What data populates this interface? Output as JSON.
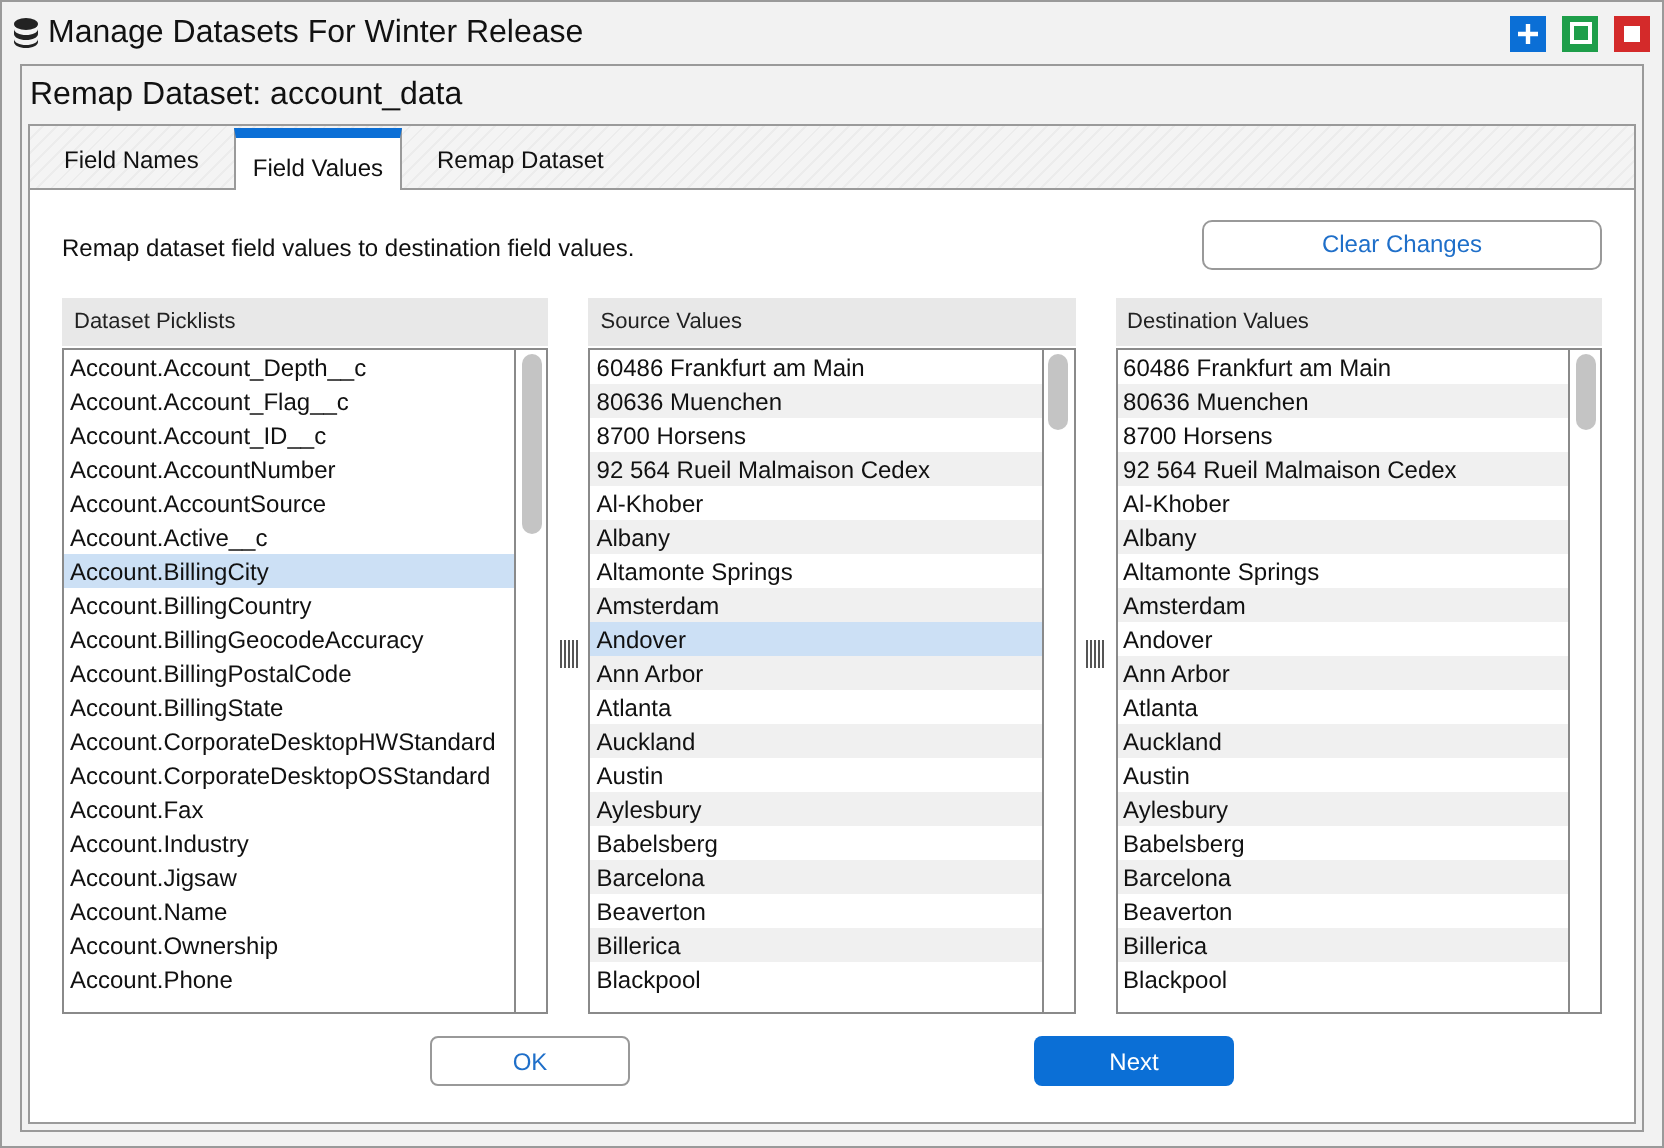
{
  "window": {
    "title": "Manage Datasets For Winter Release"
  },
  "dialog": {
    "title": "Remap Dataset: account_data"
  },
  "tabs": [
    {
      "label": "Field Names",
      "selected": false
    },
    {
      "label": "Field Values",
      "selected": true
    },
    {
      "label": "Remap Dataset",
      "selected": false
    }
  ],
  "description": "Remap dataset field values to destination field values.",
  "clear_button": "Clear Changes",
  "lists": [
    {
      "header": "Dataset Picklists",
      "striped": false,
      "items": [
        {
          "label": "Account.Account_Depth__c",
          "selected": false
        },
        {
          "label": "Account.Account_Flag__c",
          "selected": false
        },
        {
          "label": "Account.Account_ID__c",
          "selected": false
        },
        {
          "label": "Account.AccountNumber",
          "selected": false
        },
        {
          "label": "Account.AccountSource",
          "selected": false
        },
        {
          "label": "Account.Active__c",
          "selected": false
        },
        {
          "label": "Account.BillingCity",
          "selected": true
        },
        {
          "label": "Account.BillingCountry",
          "selected": false
        },
        {
          "label": "Account.BillingGeocodeAccuracy",
          "selected": false
        },
        {
          "label": "Account.BillingPostalCode",
          "selected": false
        },
        {
          "label": "Account.BillingState",
          "selected": false
        },
        {
          "label": "Account.CorporateDesktopHWStandard",
          "selected": false
        },
        {
          "label": "Account.CorporateDesktopOSStandard",
          "selected": false
        },
        {
          "label": "Account.Fax",
          "selected": false
        },
        {
          "label": "Account.Industry",
          "selected": false
        },
        {
          "label": "Account.Jigsaw",
          "selected": false
        },
        {
          "label": "Account.Name",
          "selected": false
        },
        {
          "label": "Account.Ownership",
          "selected": false
        },
        {
          "label": "Account.Phone",
          "selected": false
        }
      ]
    },
    {
      "header": "Source Values",
      "striped": true,
      "items": [
        {
          "label": "60486 Frankfurt am Main",
          "selected": false
        },
        {
          "label": "80636 Muenchen",
          "selected": false
        },
        {
          "label": "8700 Horsens",
          "selected": false
        },
        {
          "label": "92 564 Rueil Malmaison Cedex",
          "selected": false
        },
        {
          "label": "Al-Khober",
          "selected": false
        },
        {
          "label": "Albany",
          "selected": false
        },
        {
          "label": "Altamonte Springs",
          "selected": false
        },
        {
          "label": "Amsterdam",
          "selected": false
        },
        {
          "label": "Andover",
          "selected": true
        },
        {
          "label": "Ann Arbor",
          "selected": false
        },
        {
          "label": "Atlanta",
          "selected": false
        },
        {
          "label": "Auckland",
          "selected": false
        },
        {
          "label": "Austin",
          "selected": false
        },
        {
          "label": "Aylesbury",
          "selected": false
        },
        {
          "label": "Babelsberg",
          "selected": false
        },
        {
          "label": "Barcelona",
          "selected": false
        },
        {
          "label": "Beaverton",
          "selected": false
        },
        {
          "label": "Billerica",
          "selected": false
        },
        {
          "label": "Blackpool",
          "selected": false
        }
      ]
    },
    {
      "header": "Destination Values",
      "striped": true,
      "items": [
        {
          "label": "60486 Frankfurt am Main",
          "selected": false
        },
        {
          "label": "80636 Muenchen",
          "selected": false
        },
        {
          "label": "8700 Horsens",
          "selected": false
        },
        {
          "label": "92 564 Rueil Malmaison Cedex",
          "selected": false
        },
        {
          "label": "Al-Khober",
          "selected": false
        },
        {
          "label": "Albany",
          "selected": false
        },
        {
          "label": "Altamonte Springs",
          "selected": false
        },
        {
          "label": "Amsterdam",
          "selected": false
        },
        {
          "label": "Andover",
          "selected": false
        },
        {
          "label": "Ann Arbor",
          "selected": false
        },
        {
          "label": "Atlanta",
          "selected": false
        },
        {
          "label": "Auckland",
          "selected": false
        },
        {
          "label": "Austin",
          "selected": false
        },
        {
          "label": "Aylesbury",
          "selected": false
        },
        {
          "label": "Babelsberg",
          "selected": false
        },
        {
          "label": "Barcelona",
          "selected": false
        },
        {
          "label": "Beaverton",
          "selected": false
        },
        {
          "label": "Billerica",
          "selected": false
        },
        {
          "label": "Blackpool",
          "selected": false
        }
      ]
    }
  ],
  "buttons": [
    {
      "label": "OK",
      "kind": "secondary"
    },
    {
      "label": "Next",
      "kind": "primary"
    }
  ]
}
